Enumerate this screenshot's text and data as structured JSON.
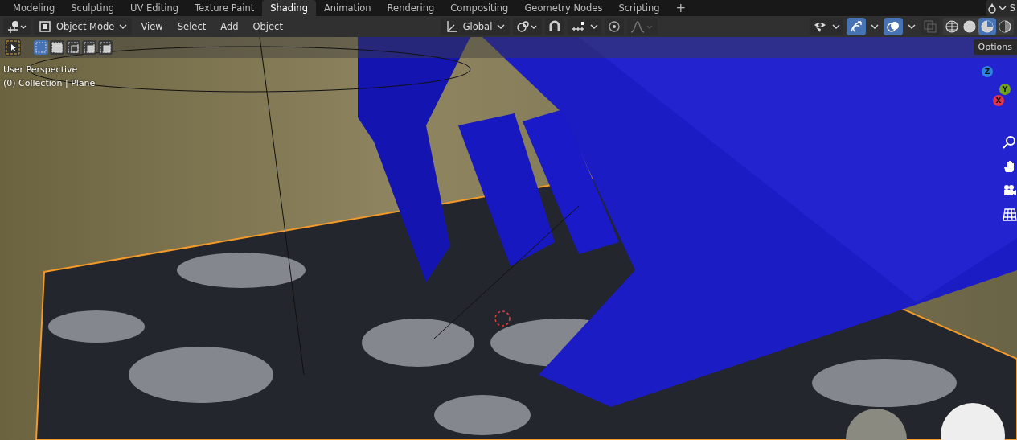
{
  "workspace_tabs": [
    {
      "label": "Modeling",
      "selected": false
    },
    {
      "label": "Sculpting",
      "selected": false
    },
    {
      "label": "UV Editing",
      "selected": false
    },
    {
      "label": "Texture Paint",
      "selected": false
    },
    {
      "label": "Shading",
      "selected": true
    },
    {
      "label": "Animation",
      "selected": false
    },
    {
      "label": "Rendering",
      "selected": false
    },
    {
      "label": "Compositing",
      "selected": false
    },
    {
      "label": "Geometry Nodes",
      "selected": false
    },
    {
      "label": "Scripting",
      "selected": false
    }
  ],
  "add_tab": "+",
  "scene_selector": "S",
  "header": {
    "mode": "Object Mode",
    "menus": [
      "View",
      "Select",
      "Add",
      "Object"
    ],
    "transform_orientation": "Global",
    "snap_on": false,
    "proportional_editing_on": false,
    "gizmos_on": true,
    "overlays_on": true,
    "xray_on": false,
    "shading_modes": [
      {
        "kind": "wireframe",
        "selected": false
      },
      {
        "kind": "solid",
        "selected": false
      },
      {
        "kind": "material",
        "selected": true
      },
      {
        "kind": "rendered",
        "selected": false
      }
    ]
  },
  "tool_row": {
    "select_modes": [
      {
        "kind": "new",
        "selected": true
      },
      {
        "kind": "extend",
        "selected": false
      },
      {
        "kind": "subtract",
        "selected": false
      },
      {
        "kind": "invert",
        "selected": false
      },
      {
        "kind": "intersect",
        "selected": false
      }
    ]
  },
  "viewport": {
    "view_name": "User Perspective",
    "collection_info": "(0) Collection | Plane",
    "options_label": "Options",
    "axes": [
      "Z",
      "Y",
      "X"
    ]
  }
}
